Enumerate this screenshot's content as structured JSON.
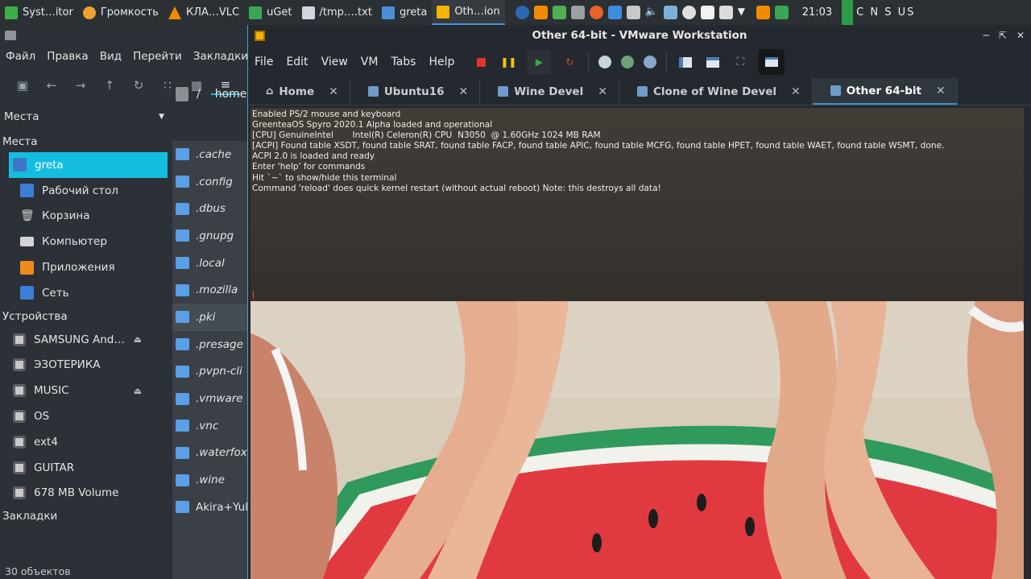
{
  "panel": {
    "tasks": [
      {
        "label": "Syst…itor",
        "icon": "system-monitor-icon",
        "color": "#3fae49"
      },
      {
        "label": "Громкость",
        "icon": "volume-control-icon",
        "color": "#f0a030"
      },
      {
        "label": "КЛА…VLC",
        "icon": "vlc-icon",
        "color": "#f28a00"
      },
      {
        "label": "uGet",
        "icon": "uget-icon",
        "color": "#3aa655"
      },
      {
        "label": "/tmp….txt",
        "icon": "text-editor-icon",
        "color": "#cfd6de"
      },
      {
        "label": "greta",
        "icon": "folder-icon",
        "color": "#4a90d9"
      },
      {
        "label": "Oth…ion",
        "icon": "vmware-icon",
        "color": "#f5b400"
      }
    ],
    "clock": "21:03",
    "keyboard_layout": "C N S US"
  },
  "file_manager": {
    "menu": [
      "Файл",
      "Правка",
      "Вид",
      "Перейти",
      "Закладки"
    ],
    "places_combo": "Места",
    "places_header": "Места",
    "places": [
      {
        "label": "greta",
        "icon": "home-folder-icon",
        "selected": true
      },
      {
        "label": "Рабочий стол",
        "icon": "desktop-icon"
      },
      {
        "label": "Корзина",
        "icon": "trash-icon"
      },
      {
        "label": "Компьютер",
        "icon": "computer-icon"
      },
      {
        "label": "Приложения",
        "icon": "applications-icon"
      },
      {
        "label": "Сеть",
        "icon": "network-icon"
      }
    ],
    "devices_header": "Устройства",
    "devices": [
      {
        "label": "SAMSUNG And…",
        "eject": true
      },
      {
        "label": "ЭЗОТЕРИКА",
        "eject": false
      },
      {
        "label": "MUSIC",
        "eject": true
      },
      {
        "label": "OS",
        "eject": false
      },
      {
        "label": "ext4",
        "eject": false
      },
      {
        "label": "GUITAR",
        "eject": false
      },
      {
        "label": "678 MB Volume",
        "eject": false
      }
    ],
    "bookmarks_header": "Закладки",
    "path_root": "/",
    "path_home": "home",
    "files": [
      ".cache",
      ".config",
      ".dbus",
      ".gnupg",
      ".local",
      ".mozilla",
      ".pki",
      ".presage",
      ".pvpn-cli",
      ".vmware",
      ".vnc",
      ".waterfox",
      ".wine",
      "Akira+Yuki"
    ],
    "highlighted_file": ".pki",
    "status": "30 объектов"
  },
  "vmware": {
    "title": "Other 64-bit - VMware Workstation",
    "menu": [
      "File",
      "Edit",
      "View",
      "VM",
      "Tabs",
      "Help"
    ],
    "tabs": [
      {
        "label": "Home",
        "icon": "home-icon",
        "active": false
      },
      {
        "label": "Ubuntu16",
        "icon": "vm-icon",
        "active": false
      },
      {
        "label": "Wine Devel",
        "icon": "vm-icon",
        "active": false
      },
      {
        "label": "Clone of Wine Devel",
        "icon": "vm-icon",
        "active": false
      },
      {
        "label": "Other 64-bit",
        "icon": "vm-icon",
        "active": true
      }
    ],
    "terminal_lines": [
      "Enabled PS/2 mouse and keyboard",
      "GreenteaOS Spyro 2020.1 Alpha loaded and operational",
      "[CPU] GenuineIntel       Intel(R) Celeron(R) CPU  N3050  @ 1.60GHz 1024 MB RAM",
      "[ACPI] Found table XSDT, found table SRAT, found table FACP, found table APIC, found table MCFG, found table HPET, found table WAET, found table WSMT, done.",
      "ACPI 2.0 is loaded and ready",
      "Enter 'help' for commands",
      "Hit `~` to show/hide this terminal",
      "Command 'reload' does quick kernel restart (without actual reboot) Note: this destroys all data!"
    ]
  }
}
